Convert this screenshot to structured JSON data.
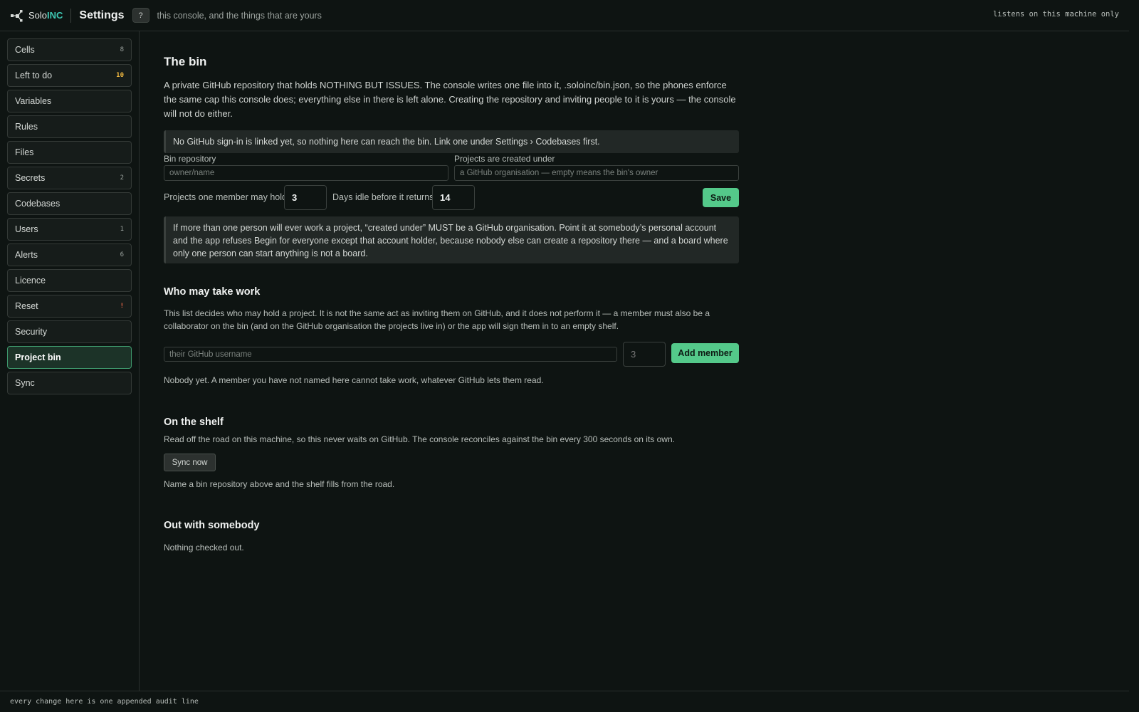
{
  "header": {
    "brand_prefix": "Solo",
    "brand_suffix": "INC",
    "title": "Settings",
    "help_label": "?",
    "subtitle": "this console, and the things that are yours",
    "host_note": "listens on this machine only"
  },
  "sidebar": {
    "items": [
      {
        "label": "Cells",
        "badge": "8"
      },
      {
        "label": "Left to do",
        "badge": "10"
      },
      {
        "label": "Variables",
        "badge": ""
      },
      {
        "label": "Rules",
        "badge": ""
      },
      {
        "label": "Files",
        "badge": ""
      },
      {
        "label": "Secrets",
        "badge": "2"
      },
      {
        "label": "Codebases",
        "badge": ""
      },
      {
        "label": "Users",
        "badge": "1"
      },
      {
        "label": "Alerts",
        "badge": "6"
      },
      {
        "label": "Licence",
        "badge": ""
      },
      {
        "label": "Reset",
        "badge": "!"
      },
      {
        "label": "Security",
        "badge": ""
      },
      {
        "label": "Project bin",
        "badge": ""
      },
      {
        "label": "Sync",
        "badge": ""
      }
    ],
    "active": "Project bin"
  },
  "bin": {
    "heading": "The bin",
    "description": "A private GitHub repository that holds NOTHING BUT ISSUES. The console writes one file into it, .soloinc/bin.json, so the phones enforce the same cap this console does; everything else in there is left alone. Creating the repository and inviting people to it is yours — the console will not do either.",
    "notice": "No GitHub sign-in is linked yet, so nothing here can reach the bin. Link one under Settings › Codebases first.",
    "repo_label": "Bin repository",
    "repo_placeholder": "owner/name",
    "owner_label": "Projects are created under",
    "owner_placeholder": "a GitHub organisation — empty means the bin's owner",
    "hold_label": "Projects one member may hold",
    "hold_value": "3",
    "idle_label": "Days idle before it returns",
    "idle_value": "14",
    "save_label": "Save",
    "warning": "If more than one person will ever work a project, “created under” MUST be a GitHub organisation. Point it at somebody’s personal account and the app refuses Begin for everyone except that account holder, because nobody else can create a repository there — and a board where only one person can start anything is not a board."
  },
  "members": {
    "heading": "Who may take work",
    "description": "This list decides who may hold a project. It is not the same act as inviting them on GitHub, and it does not perform it — a member must also be a collaborator on the bin (and on the GitHub organisation the projects live in) or the app will sign them in to an empty shelf.",
    "username_placeholder": "their GitHub username",
    "cap_placeholder": "3",
    "add_label": "Add member",
    "empty_text": "Nobody yet. A member you have not named here cannot take work, whatever GitHub lets them read."
  },
  "shelf": {
    "heading": "On the shelf",
    "description": "Read off the road on this machine, so this never waits on GitHub. The console reconciles against the bin every 300 seconds on its own.",
    "sync_label": "Sync now",
    "empty_text": "Name a bin repository above and the shelf fills from the road."
  },
  "out": {
    "heading": "Out with somebody",
    "empty_text": "Nothing checked out."
  },
  "footer": {
    "text": "every change here is one appended audit line"
  },
  "colors": {
    "accent": "#54c98a",
    "brand": "#3ec9b4",
    "warn_badge": "#f0b840",
    "alert_badge": "#f06a4a"
  }
}
